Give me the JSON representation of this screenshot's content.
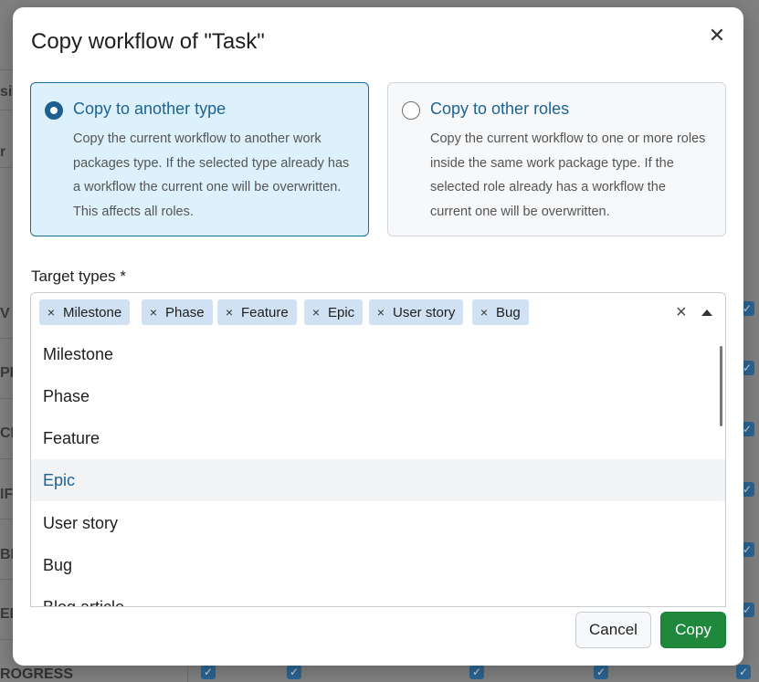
{
  "background": {
    "row_labels": [
      "sit",
      "r",
      "V",
      "PI",
      "CI",
      "IF",
      "BE",
      "EI"
    ],
    "bottom_label": "ROGRESS"
  },
  "modal": {
    "title": "Copy workflow of \"Task\"",
    "close_icon": "close-icon",
    "options": [
      {
        "title": "Copy to another type",
        "description": "Copy the current workflow to another work packages type. If the selected type already has a workflow the current one will be overwritten. This affects all roles.",
        "selected": true
      },
      {
        "title": "Copy to other roles",
        "description": "Copy the current workflow to one or more roles inside the same work package type. If the selected role already has a workflow the current one will be overwritten.",
        "selected": false
      }
    ],
    "target_label": "Target types *",
    "chips": [
      "Milestone",
      "Phase",
      "Feature",
      "Epic",
      "User story",
      "Bug"
    ],
    "dropdown_items": [
      "Milestone",
      "Phase",
      "Feature",
      "Epic",
      "User story",
      "Bug",
      "Blog article"
    ],
    "active_item": "Epic",
    "cancel_label": "Cancel",
    "copy_label": "Copy"
  },
  "colors": {
    "accent": "#1d6393",
    "selected_card_bg": "#ddf1fc",
    "chip_bg": "#cfe1f3",
    "copy_button": "#1f883d"
  }
}
